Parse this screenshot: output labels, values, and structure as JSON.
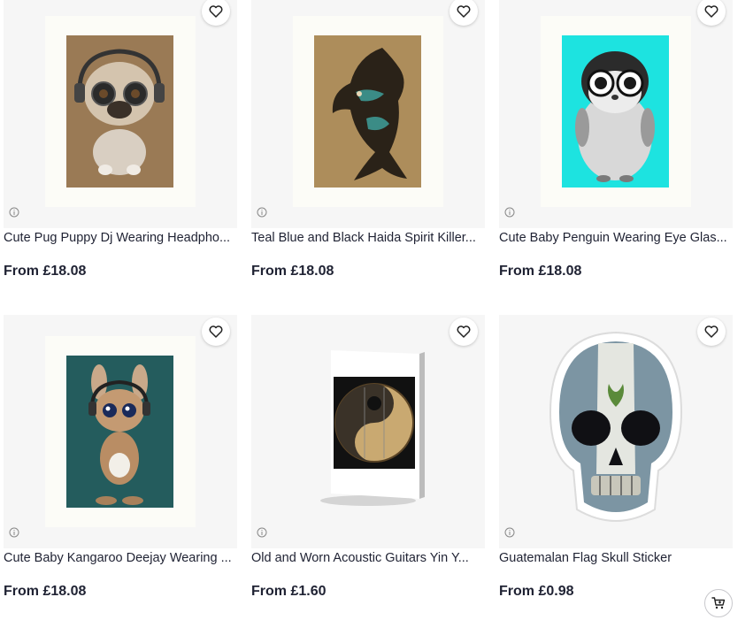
{
  "products": [
    {
      "title": "Cute Pug Puppy Dj Wearing Headpho...",
      "price": "From £18.08",
      "image": "pug-dj-art-print"
    },
    {
      "title": "Teal Blue and Black Haida Spirit Killer...",
      "price": "From £18.08",
      "image": "haida-killer-whale-art-print"
    },
    {
      "title": "Cute Baby Penguin Wearing Eye Glas...",
      "price": "From £18.08",
      "image": "penguin-glasses-art-print"
    },
    {
      "title": "Cute Baby Kangaroo Deejay Wearing ...",
      "price": "From £18.08",
      "image": "kangaroo-dj-art-print"
    },
    {
      "title": "Old and Worn Acoustic Guitars Yin Y...",
      "price": "From £1.60",
      "image": "guitar-yin-yang-greeting-card"
    },
    {
      "title": "Guatemalan Flag Skull Sticker",
      "price": "From £0.98",
      "image": "guatemala-flag-skull-sticker"
    }
  ],
  "icons": {
    "favorite": "heart-icon",
    "info": "info-icon",
    "cart": "cart-icon"
  },
  "colors": {
    "card_bg": "#f6f6f6",
    "text": "#1f2233",
    "teal_bg": "#1de3e0"
  }
}
